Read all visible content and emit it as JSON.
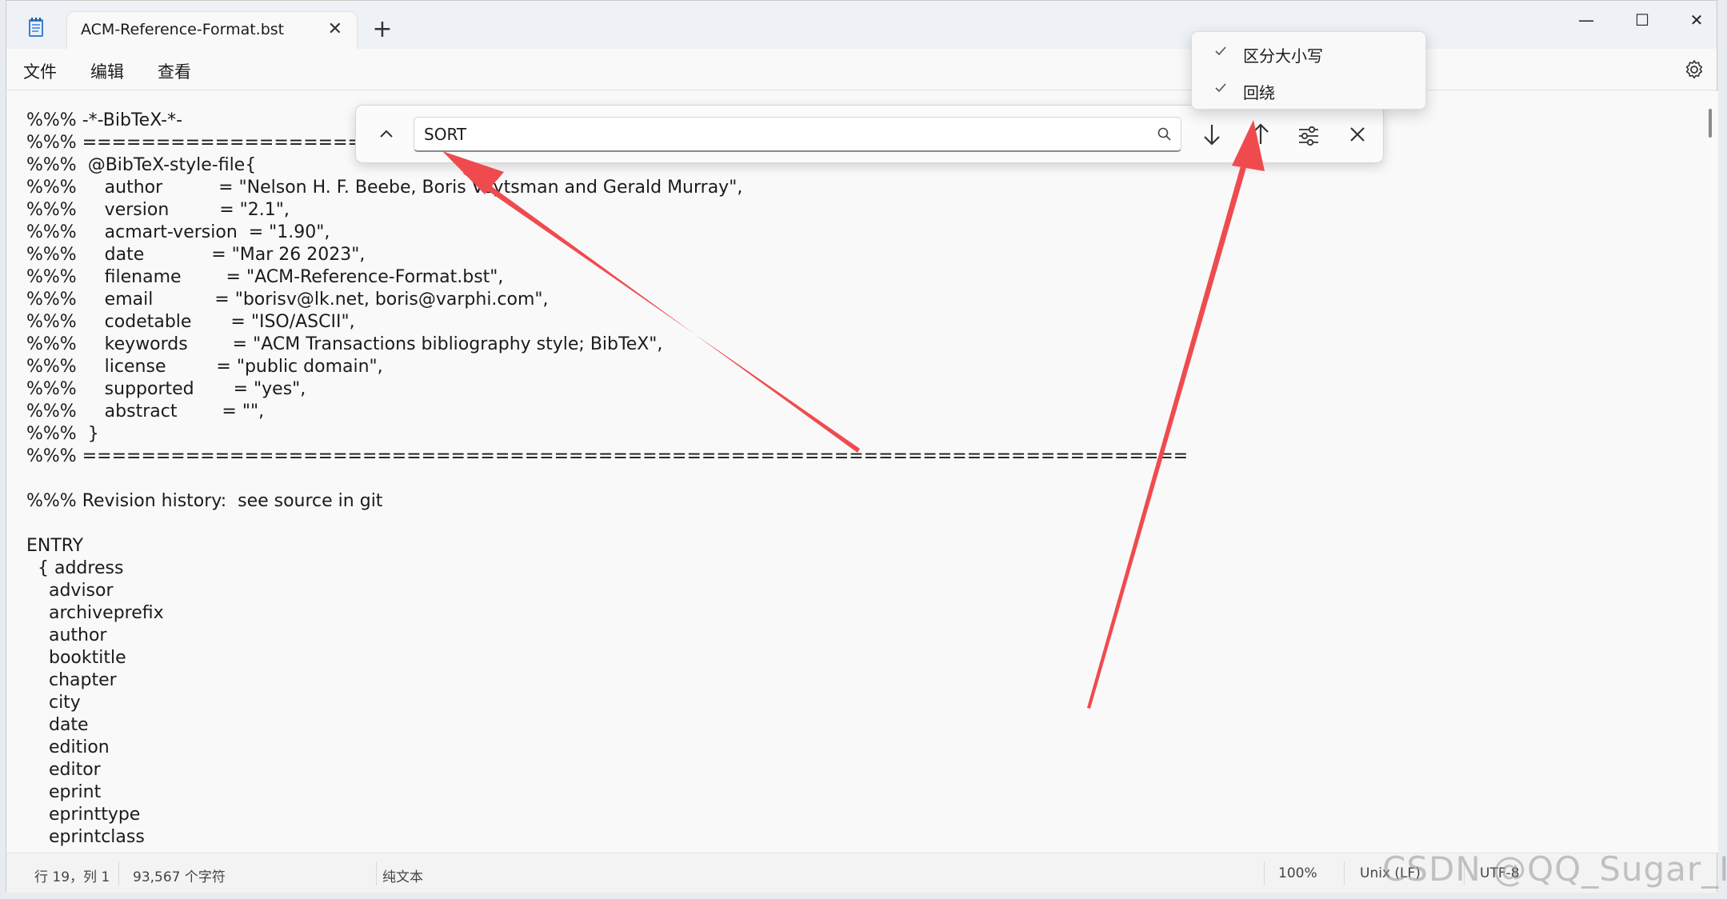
{
  "window": {
    "tab_title": "ACM-Reference-Format.bst",
    "tab_close": "✕",
    "new_tab": "+",
    "controls": {
      "minimize": "—",
      "maximize": "☐",
      "close": "✕"
    }
  },
  "menu": {
    "file": "文件",
    "edit": "编辑",
    "view": "查看"
  },
  "editor": {
    "lines": [
      "%%% -*-BibTeX-*-",
      "%%% ===========================================================================",
      "%%%  @BibTeX-style-file{",
      "%%%     author          = \"Nelson H. F. Beebe, Boris Veytsman and Gerald Murray\",",
      "%%%     version         = \"2.1\",",
      "%%%     acmart-version  = \"1.90\",",
      "%%%     date            = \"Mar 26 2023\",",
      "%%%     filename        = \"ACM-Reference-Format.bst\",",
      "%%%     email           = \"borisv@lk.net, boris@varphi.com\",",
      "%%%     codetable       = \"ISO/ASCII\",",
      "%%%     keywords        = \"ACM Transactions bibliography style; BibTeX\",",
      "%%%     license         = \"public domain\",",
      "%%%     supported       = \"yes\",",
      "%%%     abstract        = \"\",",
      "%%%  }",
      "%%% ===========================================================================",
      "",
      "%%% Revision history:  see source in git",
      "",
      "ENTRY",
      "  { address",
      "    advisor",
      "    archiveprefix",
      "    author",
      "    booktitle",
      "    chapter",
      "    city",
      "    date",
      "    edition",
      "    editor",
      "    eprint",
      "    eprinttype",
      "    eprintclass"
    ]
  },
  "find": {
    "value": "SORT",
    "options": [
      {
        "label": "区分大小写",
        "checked": true
      },
      {
        "label": "回绕",
        "checked": true
      }
    ]
  },
  "status": {
    "position": "行 19，列 1",
    "chars": "93,567 个字符",
    "format": "纯文本",
    "zoom": "100%",
    "line_ending": "Unix (LF)",
    "encoding": "UTF-8"
  },
  "watermark": "CSDN @QQ_Sugar_ICT",
  "colors": {
    "arrow": "#ef4b4f",
    "accent": "#1b1b1b"
  }
}
